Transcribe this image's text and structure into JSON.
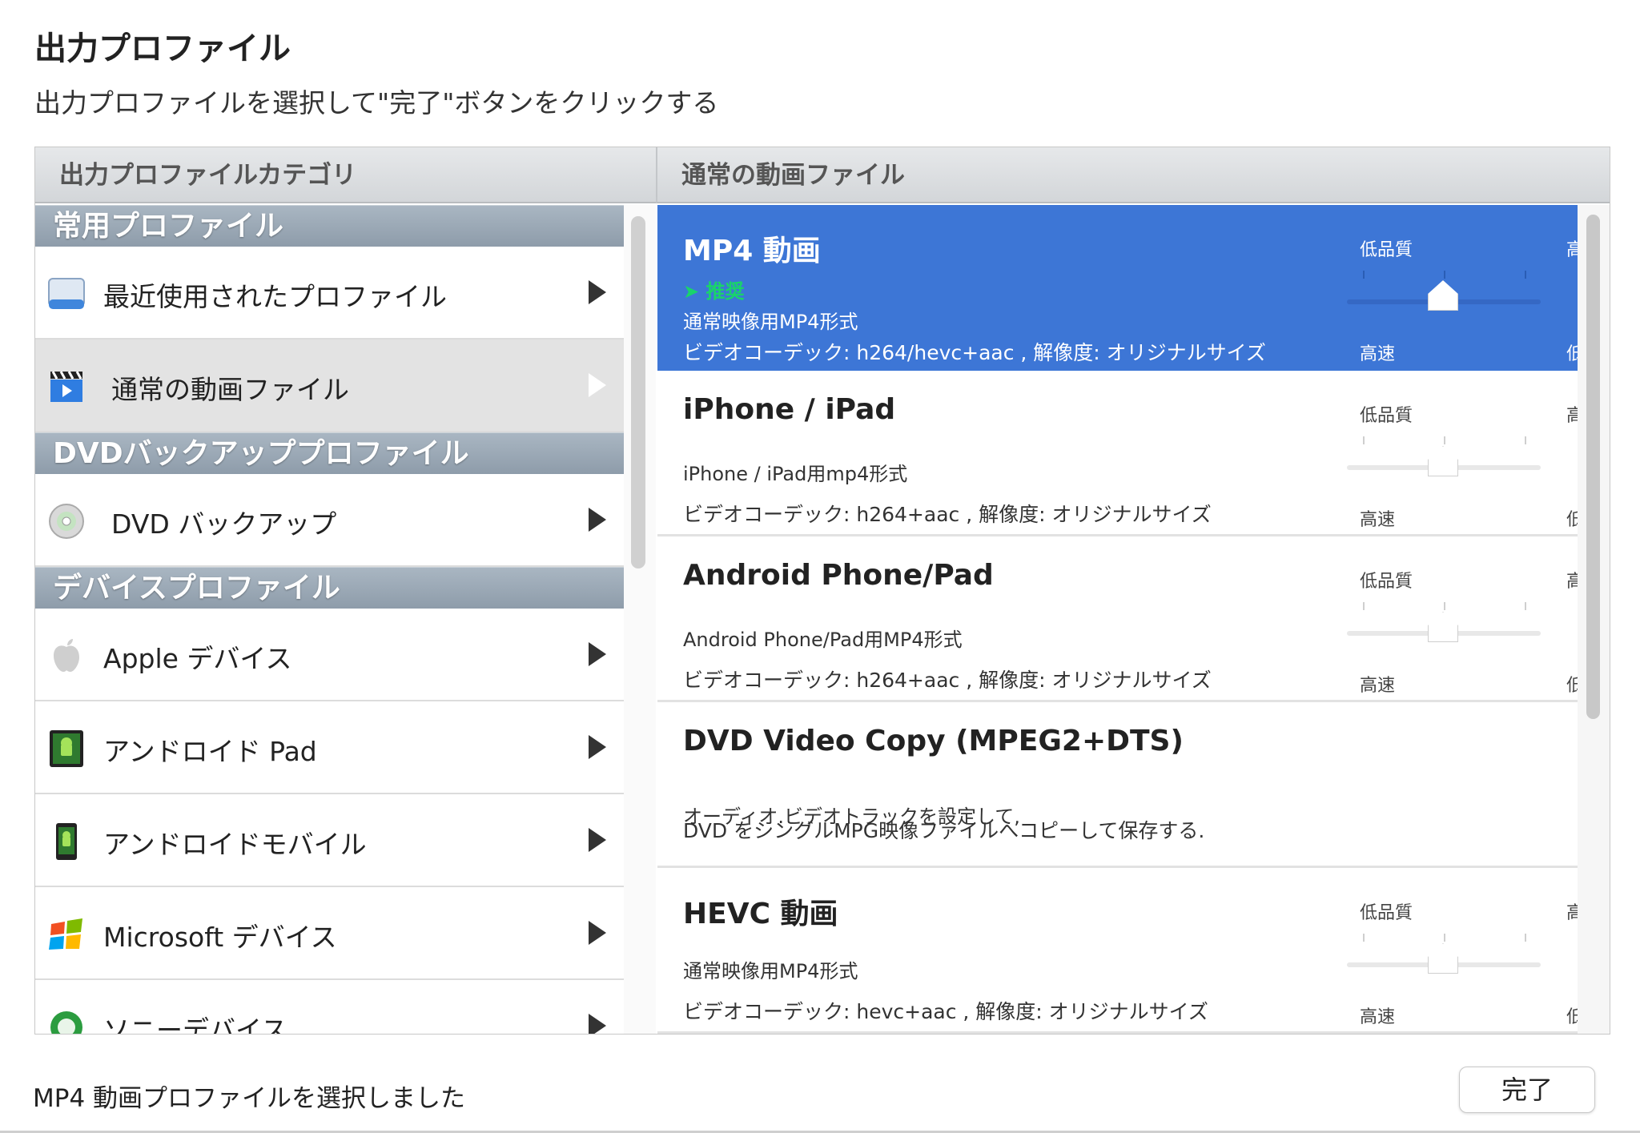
{
  "dialog": {
    "title": "出力プロファイル",
    "subtitle": "出力プロファイルを選択して\"完了\"ボタンをクリックする"
  },
  "left_column": {
    "header": "出力プロファイルカテゴリ",
    "sections": [
      {
        "label": "常用プロファイル"
      },
      {
        "label": "DVDバックアッププロファイル"
      },
      {
        "label": "デバイスプロファイル"
      }
    ],
    "items": [
      {
        "label": "最近使用されたプロファイル",
        "icon": "recent-profiles-icon"
      },
      {
        "label": "通常の動画ファイル",
        "icon": "clapperboard-icon",
        "selected": true
      },
      {
        "label": "DVD バックアップ",
        "icon": "dvd-disc-icon"
      },
      {
        "label": "Apple デバイス",
        "icon": "apple-logo-icon"
      },
      {
        "label": "アンドロイド Pad",
        "icon": "android-pad-icon"
      },
      {
        "label": "アンドロイドモバイル",
        "icon": "android-mobile-icon"
      },
      {
        "label": "Microsoft デバイス",
        "icon": "windows-logo-icon"
      },
      {
        "label": "ソニーデバイス",
        "icon": "sony-logo-icon"
      }
    ]
  },
  "right_column": {
    "header": "通常の動画ファイル",
    "slider_labels": {
      "low_quality": "低品質",
      "high_quality": "高品質",
      "fast": "高速",
      "slow": "低速"
    },
    "profiles": [
      {
        "name": "MP4 動画",
        "recommended": "➤ 推奨",
        "desc1": "通常映像用MP4形式",
        "desc2": "ビデオコーデック: h264/hevc+aac , 解像度: オリジナルサイズ",
        "selected": true,
        "has_slider": true,
        "quality_level": 0.5
      },
      {
        "name": "iPhone / iPad",
        "desc1": "iPhone / iPad用mp4形式",
        "desc2": "ビデオコーデック: h264+aac , 解像度: オリジナルサイズ",
        "has_slider": true,
        "quality_level": 0.5
      },
      {
        "name": "Android Phone/Pad",
        "desc1": "Android Phone/Pad用MP4形式",
        "desc2": "ビデオコーデック: h264+aac , 解像度: オリジナルサイズ",
        "has_slider": true,
        "quality_level": 0.5
      },
      {
        "name": "DVD Video Copy (MPEG2+DTS)",
        "desc1": "オーディオ.ビデオトラックを設定して,",
        "desc2": "DVD をシングルMPG映像ファイルへコピーして保存する.",
        "has_slider": false
      },
      {
        "name": "HEVC 動画",
        "desc1": "通常映像用MP4形式",
        "desc2": "ビデオコーデック: hevc+aac , 解像度: オリジナルサイズ",
        "has_slider": true,
        "quality_level": 0.5
      }
    ]
  },
  "footer": {
    "status": "MP4 動画プロファイルを選択しました",
    "done_label": "完了"
  },
  "colors": {
    "selection_blue": "#3d76d6",
    "recommended_green": "#19d36b",
    "section_header": "#9aa8b5"
  }
}
